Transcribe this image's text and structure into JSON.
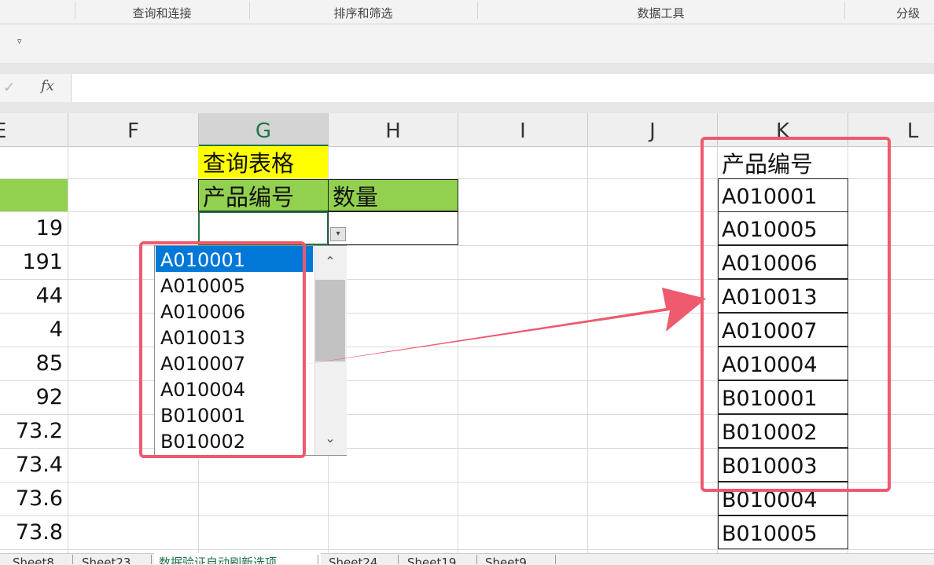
{
  "ribbon": {
    "groups": [
      "查询和连接",
      "排序和筛选",
      "数据工具",
      "分级"
    ],
    "qa_menu_glyph": "▿"
  },
  "formula_bar": {
    "check_glyph": "✓",
    "fx_label": "fx",
    "value": ""
  },
  "columns": [
    "E",
    "F",
    "G",
    "H",
    "I",
    "J",
    "K",
    "L"
  ],
  "selected_column": "G",
  "column_e_values": [
    "19",
    "191",
    "44",
    "4",
    "85",
    "92",
    "73.2",
    "73.4",
    "73.6",
    "73.8"
  ],
  "query_table": {
    "title": "查询表格",
    "col_product": "产品编号",
    "col_qty": "数量",
    "input_value": ""
  },
  "dropdown": {
    "items": [
      "A010001",
      "A010005",
      "A010006",
      "A010013",
      "A010007",
      "A010004",
      "B010001",
      "B010002"
    ],
    "selected_index": 0,
    "arrow_up": "⌃",
    "arrow_down": "⌄",
    "button_glyph": "▾"
  },
  "source_list": {
    "title": "产品编号",
    "items": [
      "A010001",
      "A010005",
      "A010006",
      "A010013",
      "A010007",
      "A010004",
      "B010001",
      "B010002",
      "B010003",
      "B010004",
      "B010005"
    ]
  },
  "sheet_tabs": {
    "tabs": [
      "Sheet8",
      "Sheet23",
      "数据验证自动刷新选项",
      "Sheet24",
      "Sheet19",
      "Sheet9"
    ],
    "active": "数据验证自动刷新选项"
  },
  "colors": {
    "header_green": "#92d050",
    "title_yellow": "#ffff00",
    "highlight_red": "#ee5a6e",
    "selection_blue": "#0078d7",
    "excel_green": "#217346"
  }
}
